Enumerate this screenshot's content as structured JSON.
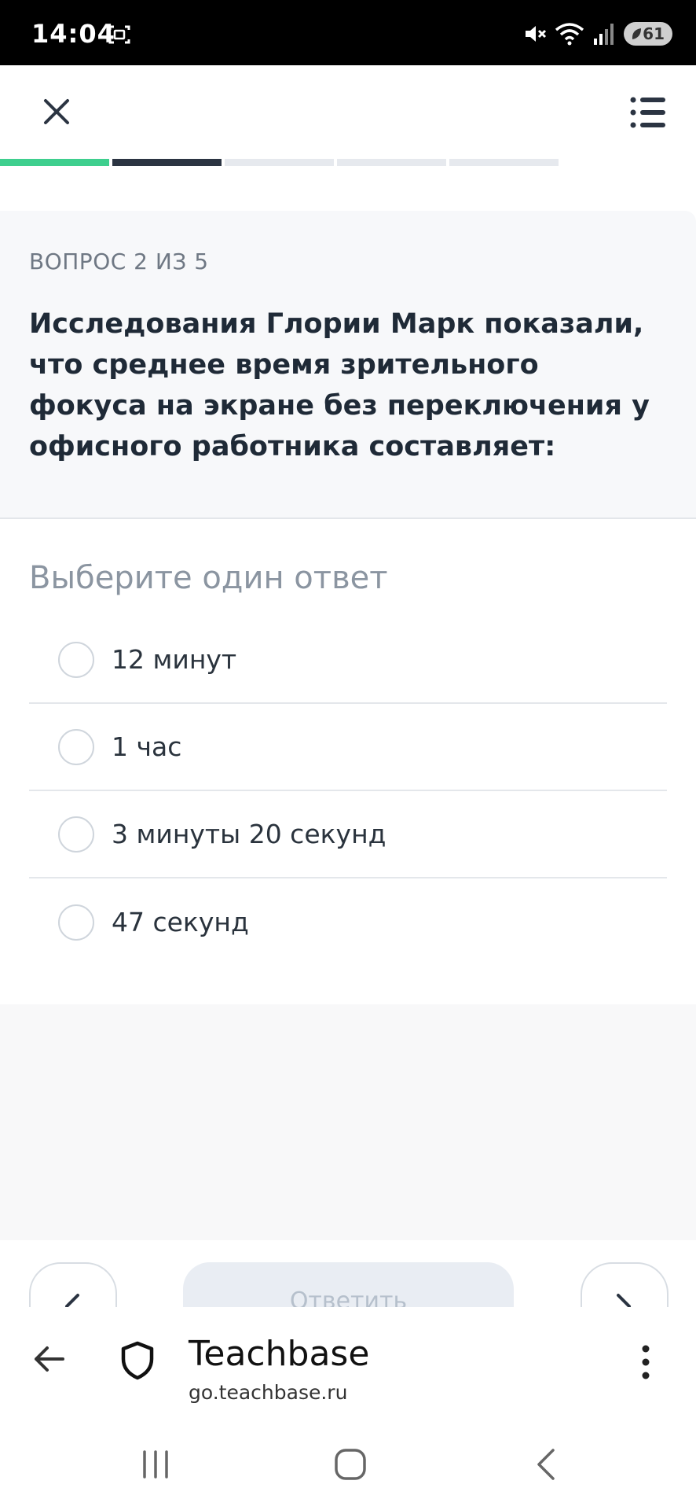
{
  "status_bar": {
    "time": "14:04",
    "battery": "61",
    "icons": [
      "screenshot-icon",
      "mute-icon",
      "wifi-icon",
      "signal-icon",
      "battery-icon"
    ]
  },
  "header": {
    "close_icon": "close-icon",
    "menu_icon": "list-menu-icon"
  },
  "progress": {
    "total": 5,
    "current": 2,
    "colors": {
      "done": "#3ecf8e",
      "current": "#2b3442",
      "pending": "#e6e9ee"
    }
  },
  "question": {
    "counter": "ВОПРОС 2 ИЗ 5",
    "text": "Исследования Глории Марк показали, что среднее время зрительного фокуса на экране без переключения у офисного работника составляет:"
  },
  "answers": {
    "instruction": "Выберите один ответ",
    "options": [
      "12 минут",
      "1 час",
      "3 минуты 20 секунд",
      "47 секунд"
    ]
  },
  "controls": {
    "submit_label": "Ответить"
  },
  "browser": {
    "title": "Teachbase",
    "url": "go.teachbase.ru"
  }
}
